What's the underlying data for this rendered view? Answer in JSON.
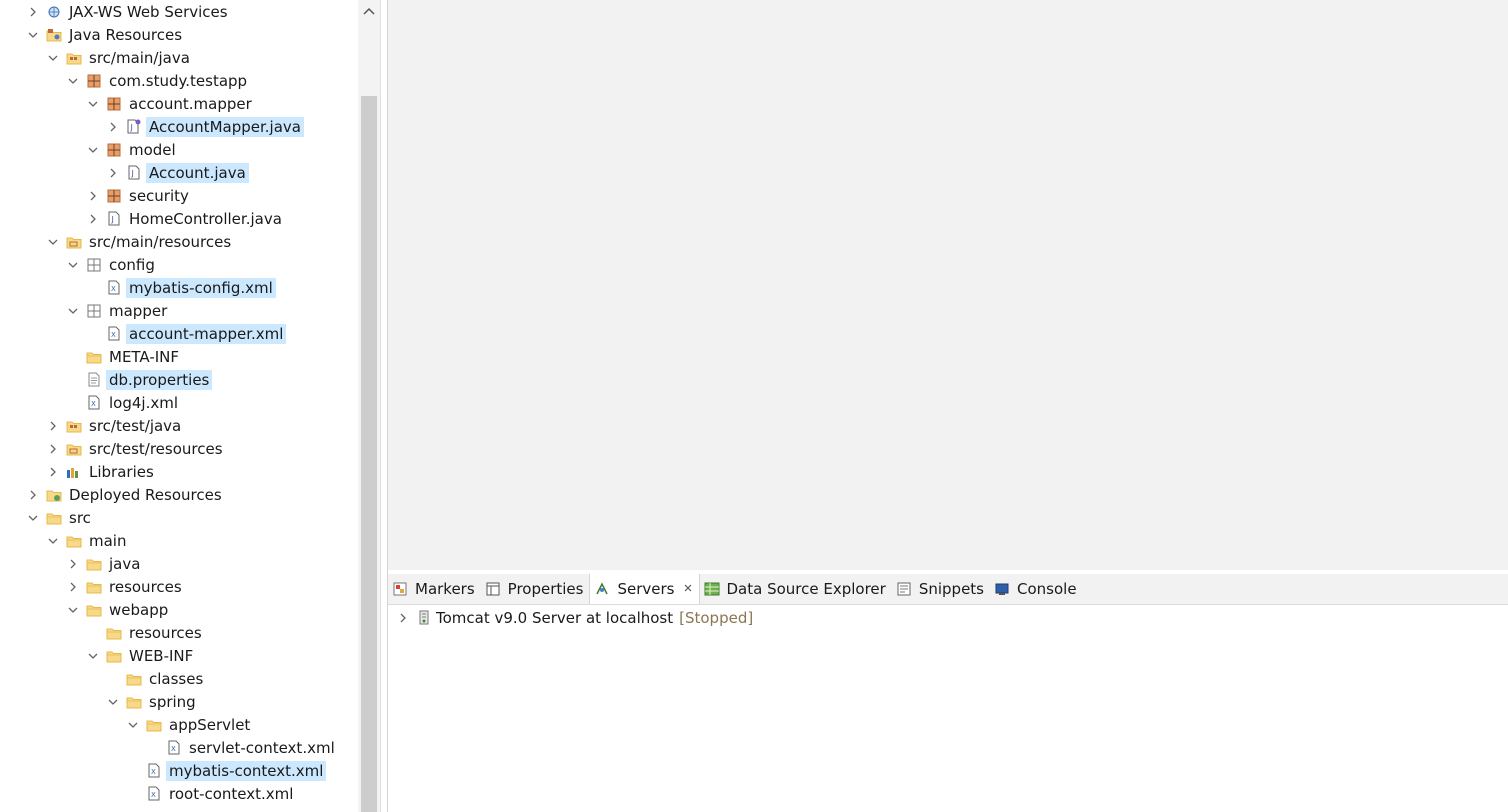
{
  "explorer": {
    "items": [
      {
        "label": "JAX-WS Web Services",
        "depth": 0,
        "chevron": "right",
        "icon": "webservice-icon",
        "selected": false
      },
      {
        "label": "Java Resources",
        "depth": 0,
        "chevron": "down",
        "icon": "java-resources-icon",
        "selected": false
      },
      {
        "label": "src/main/java",
        "depth": 1,
        "chevron": "down",
        "icon": "source-folder-icon",
        "selected": false
      },
      {
        "label": "com.study.testapp",
        "depth": 2,
        "chevron": "down",
        "icon": "package-icon",
        "selected": false
      },
      {
        "label": "account.mapper",
        "depth": 3,
        "chevron": "down",
        "icon": "package-icon",
        "selected": false
      },
      {
        "label": "AccountMapper.java",
        "depth": 4,
        "chevron": "right",
        "icon": "java-interface-file-icon",
        "selected": true
      },
      {
        "label": "model",
        "depth": 3,
        "chevron": "down",
        "icon": "package-icon",
        "selected": false
      },
      {
        "label": "Account.java",
        "depth": 4,
        "chevron": "right",
        "icon": "java-file-icon",
        "selected": true
      },
      {
        "label": "security",
        "depth": 3,
        "chevron": "right",
        "icon": "package-icon",
        "selected": false
      },
      {
        "label": "HomeController.java",
        "depth": 3,
        "chevron": "right",
        "icon": "java-file-icon",
        "selected": false
      },
      {
        "label": "src/main/resources",
        "depth": 1,
        "chevron": "down",
        "icon": "resource-folder-icon",
        "selected": false
      },
      {
        "label": "config",
        "depth": 2,
        "chevron": "down",
        "icon": "empty-package-icon",
        "selected": false
      },
      {
        "label": "mybatis-config.xml",
        "depth": 3,
        "chevron": "none",
        "icon": "xml-file-icon",
        "selected": true
      },
      {
        "label": "mapper",
        "depth": 2,
        "chevron": "down",
        "icon": "empty-package-icon",
        "selected": false
      },
      {
        "label": "account-mapper.xml",
        "depth": 3,
        "chevron": "none",
        "icon": "xml-file-icon",
        "selected": true
      },
      {
        "label": "META-INF",
        "depth": 2,
        "chevron": "none",
        "icon": "folder-icon",
        "selected": false
      },
      {
        "label": "db.properties",
        "depth": 2,
        "chevron": "none",
        "icon": "properties-file-icon",
        "selected": true
      },
      {
        "label": "log4j.xml",
        "depth": 2,
        "chevron": "none",
        "icon": "xml-file-icon",
        "selected": false
      },
      {
        "label": "src/test/java",
        "depth": 1,
        "chevron": "right",
        "icon": "source-folder-icon",
        "selected": false
      },
      {
        "label": "src/test/resources",
        "depth": 1,
        "chevron": "right",
        "icon": "resource-folder-icon",
        "selected": false
      },
      {
        "label": "Libraries",
        "depth": 1,
        "chevron": "right",
        "icon": "libraries-icon",
        "selected": false
      },
      {
        "label": "Deployed Resources",
        "depth": 0,
        "chevron": "right",
        "icon": "deployed-resources-icon",
        "selected": false
      },
      {
        "label": "src",
        "depth": 0,
        "chevron": "down",
        "icon": "folder-icon",
        "selected": false
      },
      {
        "label": "main",
        "depth": 1,
        "chevron": "down",
        "icon": "folder-icon",
        "selected": false
      },
      {
        "label": "java",
        "depth": 2,
        "chevron": "right",
        "icon": "folder-icon",
        "selected": false
      },
      {
        "label": "resources",
        "depth": 2,
        "chevron": "right",
        "icon": "folder-icon",
        "selected": false
      },
      {
        "label": "webapp",
        "depth": 2,
        "chevron": "down",
        "icon": "folder-icon",
        "selected": false
      },
      {
        "label": "resources",
        "depth": 3,
        "chevron": "none",
        "icon": "folder-icon",
        "selected": false
      },
      {
        "label": "WEB-INF",
        "depth": 3,
        "chevron": "down",
        "icon": "folder-icon",
        "selected": false
      },
      {
        "label": "classes",
        "depth": 4,
        "chevron": "none",
        "icon": "folder-icon",
        "selected": false
      },
      {
        "label": "spring",
        "depth": 4,
        "chevron": "down",
        "icon": "folder-icon",
        "selected": false
      },
      {
        "label": "appServlet",
        "depth": 5,
        "chevron": "down",
        "icon": "folder-icon",
        "selected": false
      },
      {
        "label": "servlet-context.xml",
        "depth": 6,
        "chevron": "none",
        "icon": "xml-file-icon",
        "selected": false
      },
      {
        "label": "mybatis-context.xml",
        "depth": 5,
        "chevron": "none",
        "icon": "xml-file-icon",
        "selected": true
      },
      {
        "label": "root-context.xml",
        "depth": 5,
        "chevron": "none",
        "icon": "xml-file-icon",
        "selected": false
      }
    ]
  },
  "bottom_panel": {
    "tabs": [
      {
        "label": "Markers",
        "icon": "markers-icon",
        "active": false,
        "closable": false
      },
      {
        "label": "Properties",
        "icon": "properties-view-icon",
        "active": false,
        "closable": false
      },
      {
        "label": "Servers",
        "icon": "servers-icon",
        "active": true,
        "closable": true
      },
      {
        "label": "Data Source Explorer",
        "icon": "data-source-explorer-icon",
        "active": false,
        "closable": false
      },
      {
        "label": "Snippets",
        "icon": "snippets-icon",
        "active": false,
        "closable": false
      },
      {
        "label": "Console",
        "icon": "console-icon",
        "active": false,
        "closable": false
      }
    ],
    "servers": [
      {
        "name": "Tomcat v9.0 Server at localhost",
        "status": "[Stopped]",
        "icon": "tomcat-server-icon"
      }
    ]
  },
  "colors": {
    "selection": "#cce8ff",
    "editor_bg": "#f2f2f2",
    "scroll_thumb": "#cdcdcd",
    "folder": "#e8b84a",
    "package": "#b86b3a",
    "status_text": "#8a7650"
  }
}
